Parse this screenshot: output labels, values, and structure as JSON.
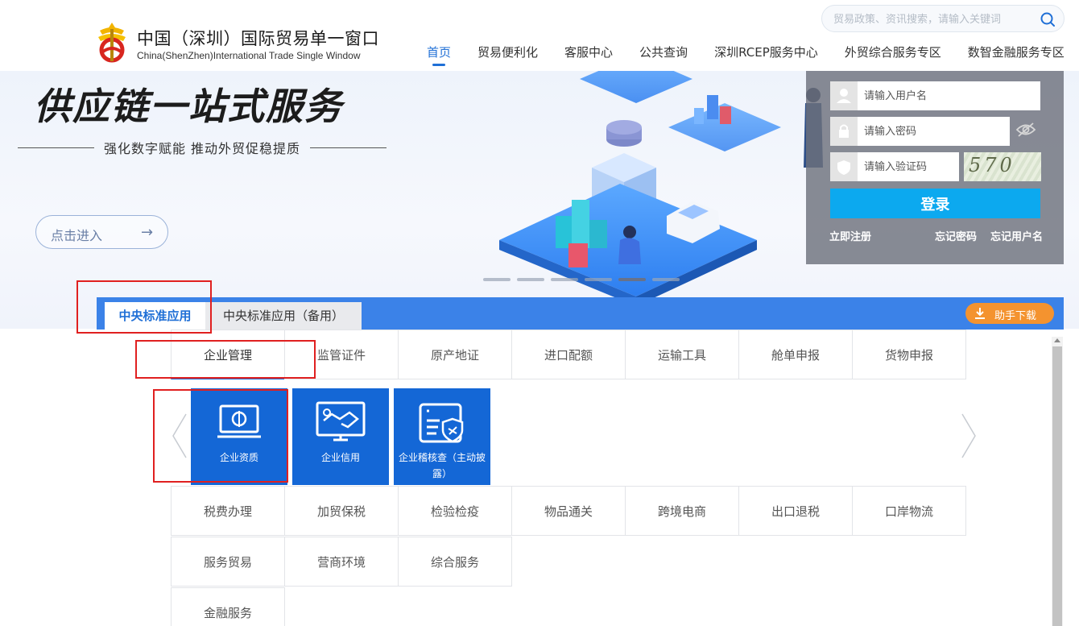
{
  "header": {
    "title_cn": "中国（深圳）国际贸易单一窗口",
    "title_en": "China(ShenZhen)International Trade Single Window",
    "search_placeholder": "贸易政策、资讯搜索，请输入关键词",
    "nav": [
      {
        "label": "首页",
        "active": true
      },
      {
        "label": "贸易便利化",
        "active": false
      },
      {
        "label": "客服中心",
        "active": false
      },
      {
        "label": "公共查询",
        "active": false
      },
      {
        "label": "深圳RCEP服务中心",
        "active": false
      },
      {
        "label": "外贸综合服务专区",
        "active": false
      },
      {
        "label": "数智金融服务专区",
        "active": false
      }
    ]
  },
  "banner": {
    "title": "供应链一站式服务",
    "subtitle": "强化数字赋能 推动外贸促稳提质",
    "enter_label": "点击进入",
    "enter_arrow": "→",
    "slide_count": 6,
    "active_slide": 4
  },
  "login": {
    "username_placeholder": "请输入用户名",
    "password_placeholder": "请输入密码",
    "captcha_placeholder": "请输入验证码",
    "captcha_text": "570",
    "login_button": "登录",
    "register": "立即注册",
    "forgot_password": "忘记密码",
    "forgot_username": "忘记用户名"
  },
  "tabs": {
    "primary": "中央标准应用",
    "backup": "中央标准应用（备用）",
    "helper_download": "助手下载"
  },
  "categories": {
    "row1": [
      "企业管理",
      "监管证件",
      "原产地证",
      "进口配额",
      "运输工具",
      "舱单申报",
      "货物申报"
    ],
    "row2": [
      "税费办理",
      "加贸保税",
      "检验检疫",
      "物品通关",
      "跨境电商",
      "出口退税",
      "口岸物流"
    ],
    "row3": [
      "服务贸易",
      "营商环境",
      "综合服务"
    ],
    "row4": [
      "金融服务"
    ],
    "selected": "企业管理"
  },
  "tiles": [
    {
      "label": "企业资质",
      "icon": "monitor-logo-icon"
    },
    {
      "label": "企业信用",
      "icon": "handshake-icon"
    },
    {
      "label": "企业稽核查（主动披露）",
      "icon": "document-shield-icon"
    }
  ],
  "colors": {
    "primary_blue": "#1f6fd6",
    "tab_bar": "#3b82e8",
    "tile_blue": "#1467d6",
    "login_button": "#0ca9ef",
    "helper_orange": "#f4932f",
    "annotation_red": "#e02020"
  }
}
